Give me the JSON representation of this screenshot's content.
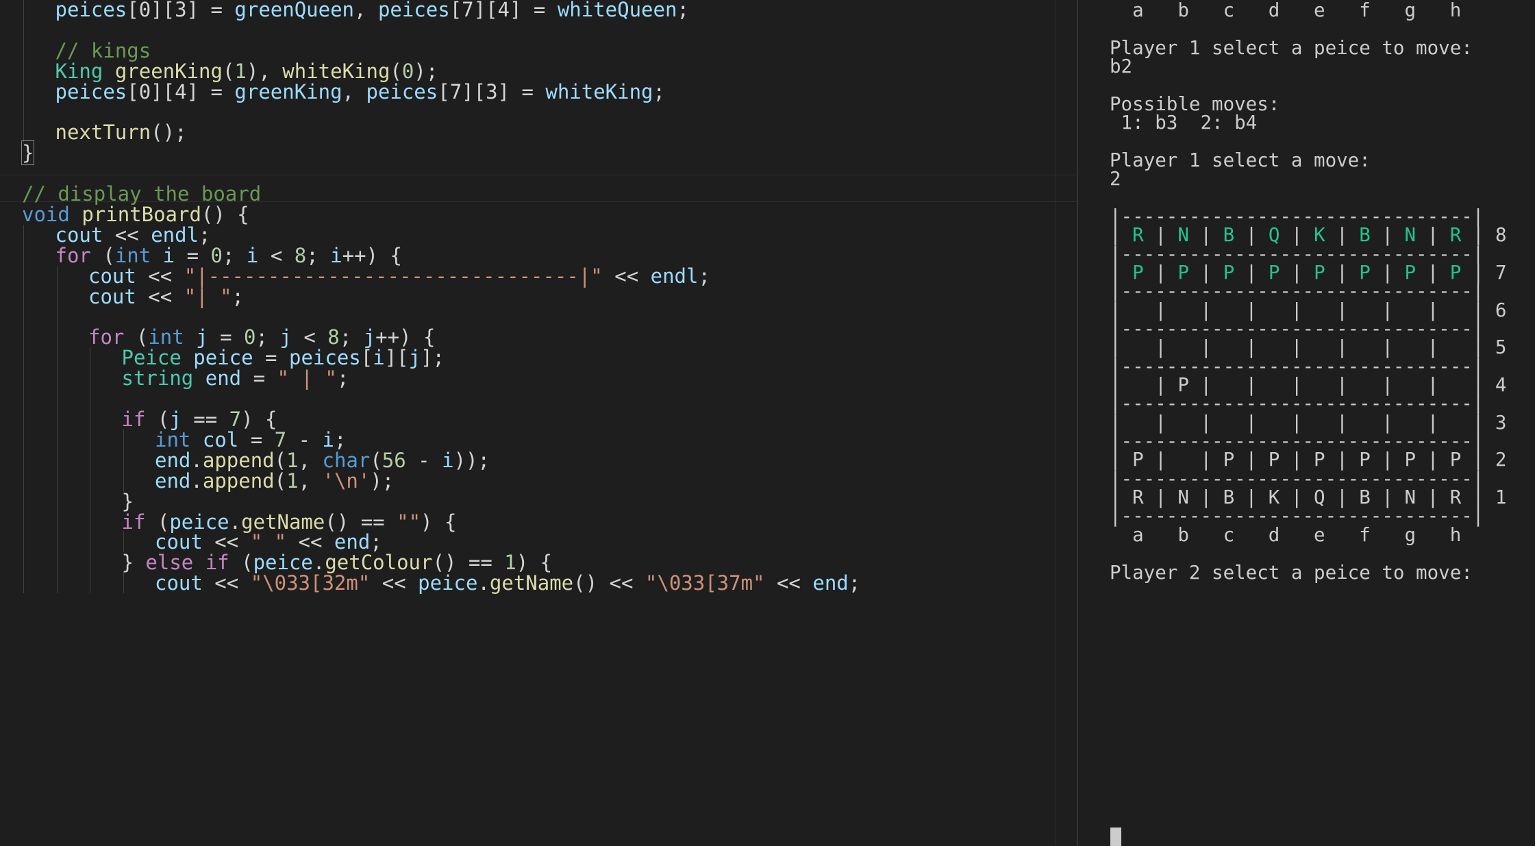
{
  "editor": {
    "lines": [
      {
        "indent": 1,
        "tokens": [
          [
            "var",
            "peices"
          ],
          [
            "pun",
            "[0][3] = "
          ],
          [
            "var",
            "greenQueen"
          ],
          [
            "pun",
            ", "
          ],
          [
            "var",
            "peices"
          ],
          [
            "pun",
            "[7][4] = "
          ],
          [
            "var",
            "whiteQueen"
          ],
          [
            "pun",
            ";"
          ]
        ]
      },
      {
        "indent": 0,
        "tokens": []
      },
      {
        "indent": 1,
        "tokens": [
          [
            "cmt",
            "// kings"
          ]
        ]
      },
      {
        "indent": 1,
        "tokens": [
          [
            "cls",
            "King"
          ],
          [
            "pun",
            " "
          ],
          [
            "fn",
            "greenKing"
          ],
          [
            "pun",
            "("
          ],
          [
            "num",
            "1"
          ],
          [
            "pun",
            "), "
          ],
          [
            "fn",
            "whiteKing"
          ],
          [
            "pun",
            "("
          ],
          [
            "num",
            "0"
          ],
          [
            "pun",
            ");"
          ]
        ]
      },
      {
        "indent": 1,
        "tokens": [
          [
            "var",
            "peices"
          ],
          [
            "pun",
            "[0][4] = "
          ],
          [
            "var",
            "greenKing"
          ],
          [
            "pun",
            ", "
          ],
          [
            "var",
            "peices"
          ],
          [
            "pun",
            "[7][3] = "
          ],
          [
            "var",
            "whiteKing"
          ],
          [
            "pun",
            ";"
          ]
        ]
      },
      {
        "indent": 0,
        "tokens": []
      },
      {
        "indent": 1,
        "tokens": [
          [
            "fn",
            "nextTurn"
          ],
          [
            "pun",
            "();"
          ]
        ]
      },
      {
        "indent": 0,
        "tokens": [
          [
            "bracket",
            "}"
          ]
        ]
      },
      {
        "indent": 0,
        "tokens": []
      },
      {
        "indent": 0,
        "tokens": [
          [
            "cmt",
            "// display the board"
          ]
        ]
      },
      {
        "indent": 0,
        "tokens": [
          [
            "type",
            "void"
          ],
          [
            "pun",
            " "
          ],
          [
            "fn",
            "printBoard"
          ],
          [
            "pun",
            "() {"
          ]
        ]
      },
      {
        "indent": 1,
        "tokens": [
          [
            "var",
            "cout"
          ],
          [
            "pun",
            " << "
          ],
          [
            "var",
            "endl"
          ],
          [
            "pun",
            ";"
          ]
        ]
      },
      {
        "indent": 1,
        "tokens": [
          [
            "kw",
            "for"
          ],
          [
            "pun",
            " ("
          ],
          [
            "type",
            "int"
          ],
          [
            "pun",
            " "
          ],
          [
            "var",
            "i"
          ],
          [
            "pun",
            " = "
          ],
          [
            "num",
            "0"
          ],
          [
            "pun",
            "; "
          ],
          [
            "var",
            "i"
          ],
          [
            "pun",
            " < "
          ],
          [
            "num",
            "8"
          ],
          [
            "pun",
            "; "
          ],
          [
            "var",
            "i"
          ],
          [
            "pun",
            "++) {"
          ]
        ]
      },
      {
        "indent": 2,
        "tokens": [
          [
            "var",
            "cout"
          ],
          [
            "pun",
            " << "
          ],
          [
            "str",
            "\"|-------------------------------|\""
          ],
          [
            "pun",
            " << "
          ],
          [
            "var",
            "endl"
          ],
          [
            "pun",
            ";"
          ]
        ]
      },
      {
        "indent": 2,
        "tokens": [
          [
            "var",
            "cout"
          ],
          [
            "pun",
            " << "
          ],
          [
            "str",
            "\"| \""
          ],
          [
            "pun",
            ";"
          ]
        ]
      },
      {
        "indent": 0,
        "tokens": []
      },
      {
        "indent": 2,
        "tokens": [
          [
            "kw",
            "for"
          ],
          [
            "pun",
            " ("
          ],
          [
            "type",
            "int"
          ],
          [
            "pun",
            " "
          ],
          [
            "var",
            "j"
          ],
          [
            "pun",
            " = "
          ],
          [
            "num",
            "0"
          ],
          [
            "pun",
            "; "
          ],
          [
            "var",
            "j"
          ],
          [
            "pun",
            " < "
          ],
          [
            "num",
            "8"
          ],
          [
            "pun",
            "; "
          ],
          [
            "var",
            "j"
          ],
          [
            "pun",
            "++) {"
          ]
        ]
      },
      {
        "indent": 3,
        "tokens": [
          [
            "cls",
            "Peice"
          ],
          [
            "pun",
            " "
          ],
          [
            "var",
            "peice"
          ],
          [
            "pun",
            " = "
          ],
          [
            "var",
            "peices"
          ],
          [
            "pun",
            "["
          ],
          [
            "var",
            "i"
          ],
          [
            "pun",
            "]["
          ],
          [
            "var",
            "j"
          ],
          [
            "pun",
            "];"
          ]
        ]
      },
      {
        "indent": 3,
        "tokens": [
          [
            "cls",
            "string"
          ],
          [
            "pun",
            " "
          ],
          [
            "var",
            "end"
          ],
          [
            "pun",
            " = "
          ],
          [
            "str",
            "\" | \""
          ],
          [
            "pun",
            ";"
          ]
        ]
      },
      {
        "indent": 0,
        "tokens": []
      },
      {
        "indent": 3,
        "tokens": [
          [
            "kw",
            "if"
          ],
          [
            "pun",
            " ("
          ],
          [
            "var",
            "j"
          ],
          [
            "pun",
            " == "
          ],
          [
            "num",
            "7"
          ],
          [
            "pun",
            ") {"
          ]
        ]
      },
      {
        "indent": 4,
        "tokens": [
          [
            "type",
            "int"
          ],
          [
            "pun",
            " "
          ],
          [
            "var",
            "col"
          ],
          [
            "pun",
            " = "
          ],
          [
            "num",
            "7"
          ],
          [
            "pun",
            " - "
          ],
          [
            "var",
            "i"
          ],
          [
            "pun",
            ";"
          ]
        ]
      },
      {
        "indent": 4,
        "tokens": [
          [
            "var",
            "end"
          ],
          [
            "pun",
            "."
          ],
          [
            "fn",
            "append"
          ],
          [
            "pun",
            "("
          ],
          [
            "num",
            "1"
          ],
          [
            "pun",
            ", "
          ],
          [
            "type",
            "char"
          ],
          [
            "pun",
            "("
          ],
          [
            "num",
            "56"
          ],
          [
            "pun",
            " - "
          ],
          [
            "var",
            "i"
          ],
          [
            "pun",
            "));"
          ]
        ]
      },
      {
        "indent": 4,
        "tokens": [
          [
            "var",
            "end"
          ],
          [
            "pun",
            "."
          ],
          [
            "fn",
            "append"
          ],
          [
            "pun",
            "("
          ],
          [
            "num",
            "1"
          ],
          [
            "pun",
            ", "
          ],
          [
            "str",
            "'\\n'"
          ],
          [
            "pun",
            ");"
          ]
        ]
      },
      {
        "indent": 3,
        "tokens": [
          [
            "pun",
            "}"
          ]
        ]
      },
      {
        "indent": 3,
        "tokens": [
          [
            "kw",
            "if"
          ],
          [
            "pun",
            " ("
          ],
          [
            "var",
            "peice"
          ],
          [
            "pun",
            "."
          ],
          [
            "fn",
            "getName"
          ],
          [
            "pun",
            "() == "
          ],
          [
            "str",
            "\"\""
          ],
          [
            "pun",
            ") {"
          ]
        ]
      },
      {
        "indent": 4,
        "tokens": [
          [
            "var",
            "cout"
          ],
          [
            "pun",
            " << "
          ],
          [
            "str",
            "\" \""
          ],
          [
            "pun",
            " << "
          ],
          [
            "var",
            "end"
          ],
          [
            "pun",
            ";"
          ]
        ]
      },
      {
        "indent": 3,
        "tokens": [
          [
            "pun",
            "} "
          ],
          [
            "kw",
            "else if"
          ],
          [
            "pun",
            " ("
          ],
          [
            "var",
            "peice"
          ],
          [
            "pun",
            "."
          ],
          [
            "fn",
            "getColour"
          ],
          [
            "pun",
            "() == "
          ],
          [
            "num",
            "1"
          ],
          [
            "pun",
            ") {"
          ]
        ]
      },
      {
        "indent": 4,
        "tokens": [
          [
            "var",
            "cout"
          ],
          [
            "pun",
            " << "
          ],
          [
            "str",
            "\"\\033[32m\""
          ],
          [
            "pun",
            " << "
          ],
          [
            "var",
            "peice"
          ],
          [
            "pun",
            "."
          ],
          [
            "fn",
            "getName"
          ],
          [
            "pun",
            "() << "
          ],
          [
            "str",
            "\"\\033[37m\""
          ],
          [
            "pun",
            " << "
          ],
          [
            "var",
            "end"
          ],
          [
            "pun",
            ";"
          ]
        ]
      }
    ]
  },
  "terminal": {
    "lines": [
      [
        [
          "t",
          "  a   b   c   d   e   f   g   h"
        ]
      ],
      [
        [
          "t",
          ""
        ]
      ],
      [
        [
          "t",
          "Player 1 select a peice to move:"
        ]
      ],
      [
        [
          "t",
          "b2"
        ]
      ],
      [
        [
          "t",
          ""
        ]
      ],
      [
        [
          "t",
          "Possible moves:"
        ]
      ],
      [
        [
          "t",
          " 1: b3  2: b4"
        ]
      ],
      [
        [
          "t",
          ""
        ]
      ],
      [
        [
          "t",
          "Player 1 select a move:"
        ]
      ],
      [
        [
          "t",
          "2"
        ]
      ],
      [
        [
          "t",
          ""
        ]
      ],
      [
        [
          "t",
          "|-------------------------------|"
        ]
      ],
      [
        [
          "t",
          "| "
        ],
        [
          "g",
          "R"
        ],
        [
          "t",
          " | "
        ],
        [
          "g",
          "N"
        ],
        [
          "t",
          " | "
        ],
        [
          "g",
          "B"
        ],
        [
          "t",
          " | "
        ],
        [
          "g",
          "Q"
        ],
        [
          "t",
          " | "
        ],
        [
          "g",
          "K"
        ],
        [
          "t",
          " | "
        ],
        [
          "g",
          "B"
        ],
        [
          "t",
          " | "
        ],
        [
          "g",
          "N"
        ],
        [
          "t",
          " | "
        ],
        [
          "g",
          "R"
        ],
        [
          "t",
          " | 8"
        ]
      ],
      [
        [
          "t",
          "|-------------------------------|"
        ]
      ],
      [
        [
          "t",
          "| "
        ],
        [
          "g",
          "P"
        ],
        [
          "t",
          " | "
        ],
        [
          "g",
          "P"
        ],
        [
          "t",
          " | "
        ],
        [
          "g",
          "P"
        ],
        [
          "t",
          " | "
        ],
        [
          "g",
          "P"
        ],
        [
          "t",
          " | "
        ],
        [
          "g",
          "P"
        ],
        [
          "t",
          " | "
        ],
        [
          "g",
          "P"
        ],
        [
          "t",
          " | "
        ],
        [
          "g",
          "P"
        ],
        [
          "t",
          " | "
        ],
        [
          "g",
          "P"
        ],
        [
          "t",
          " | 7"
        ]
      ],
      [
        [
          "t",
          "|-------------------------------|"
        ]
      ],
      [
        [
          "t",
          "|   |   |   |   |   |   |   |   | 6"
        ]
      ],
      [
        [
          "t",
          "|-------------------------------|"
        ]
      ],
      [
        [
          "t",
          "|   |   |   |   |   |   |   |   | 5"
        ]
      ],
      [
        [
          "t",
          "|-------------------------------|"
        ]
      ],
      [
        [
          "t",
          "|   | P |   |   |   |   |   |   | 4"
        ]
      ],
      [
        [
          "t",
          "|-------------------------------|"
        ]
      ],
      [
        [
          "t",
          "|   |   |   |   |   |   |   |   | 3"
        ]
      ],
      [
        [
          "t",
          "|-------------------------------|"
        ]
      ],
      [
        [
          "t",
          "| P |   | P | P | P | P | P | P | 2"
        ]
      ],
      [
        [
          "t",
          "|-------------------------------|"
        ]
      ],
      [
        [
          "t",
          "| R | N | B | K | Q | B | N | R | 1"
        ]
      ],
      [
        [
          "t",
          "|-------------------------------|"
        ]
      ],
      [
        [
          "t",
          "  a   b   c   d   e   f   g   h"
        ]
      ],
      [
        [
          "t",
          ""
        ]
      ],
      [
        [
          "t",
          "Player 2 select a peice to move:"
        ]
      ]
    ]
  }
}
